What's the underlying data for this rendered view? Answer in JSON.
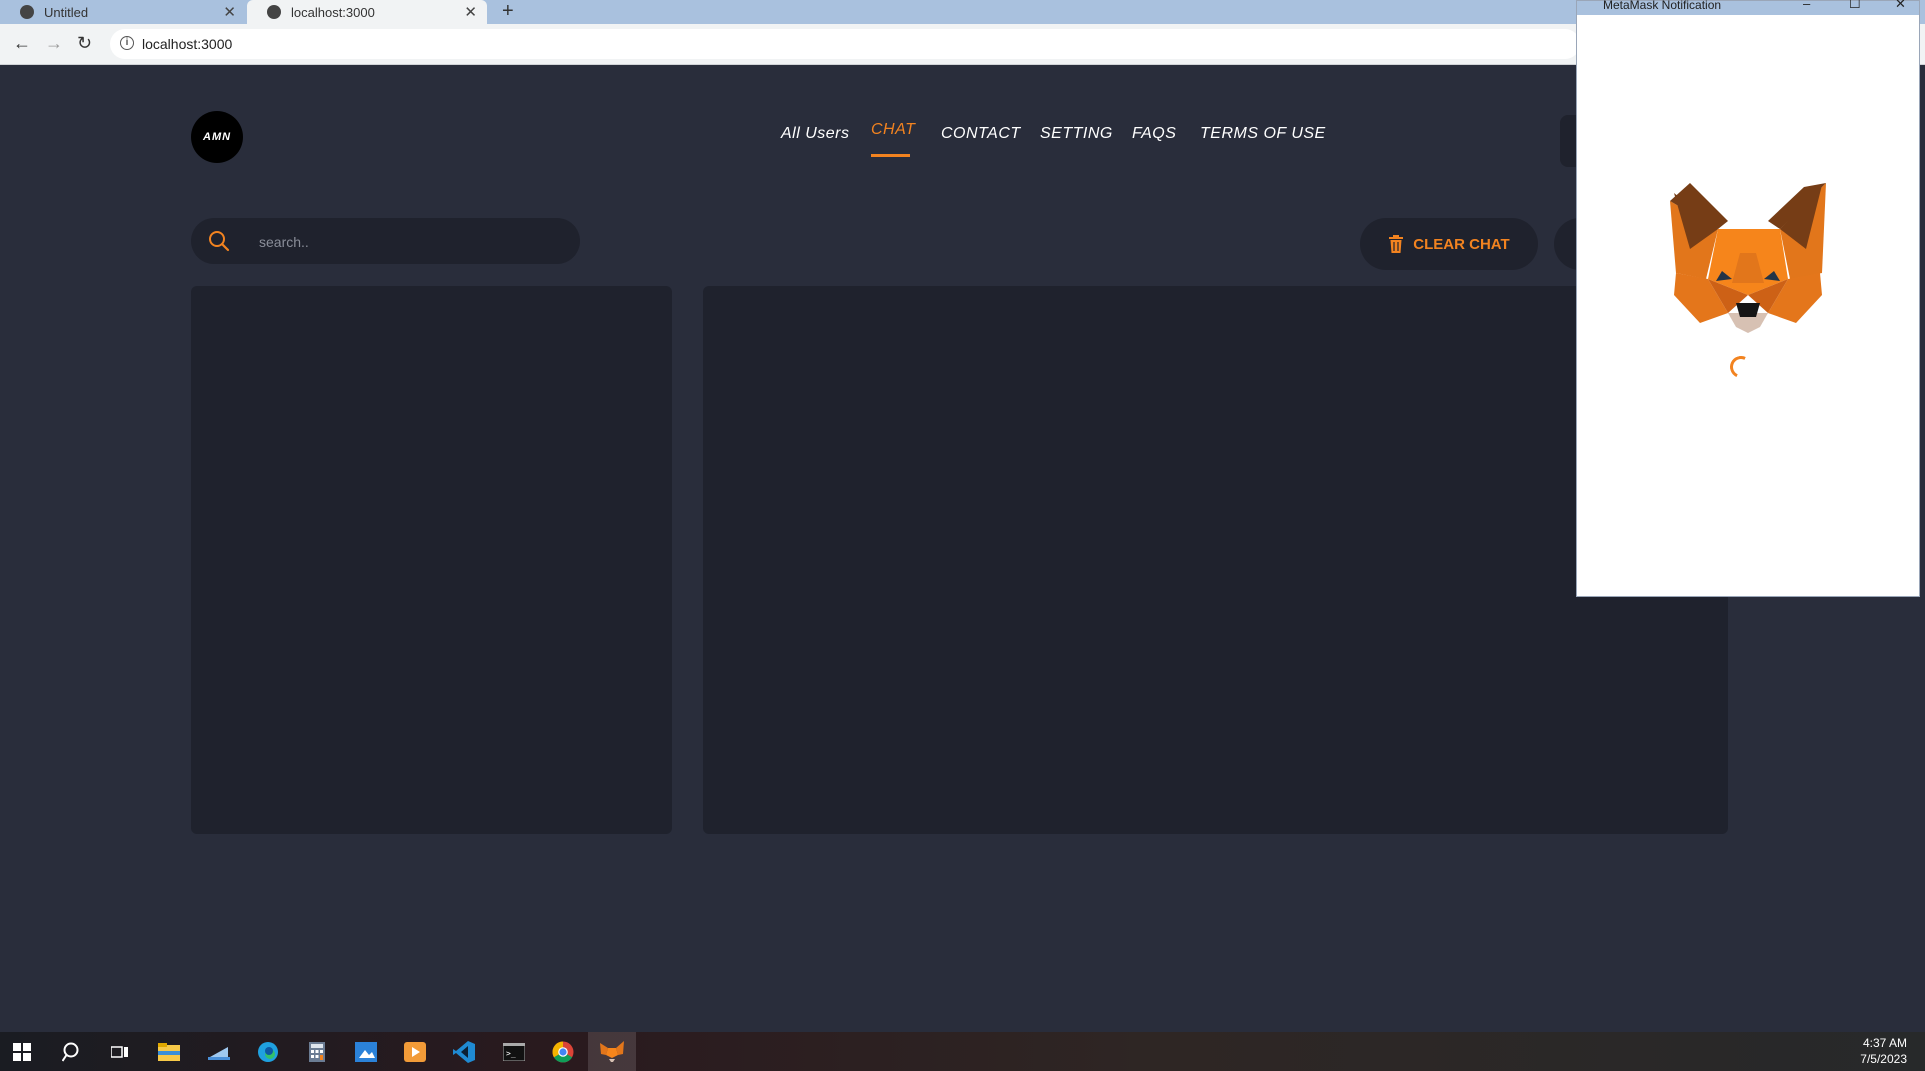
{
  "browser": {
    "tabs": [
      {
        "title": "Untitled",
        "active": false
      },
      {
        "title": "localhost:3000",
        "active": true
      }
    ],
    "url": "localhost:3000"
  },
  "site": {
    "logo_text": "AMN",
    "nav": [
      {
        "label": "All Users",
        "active": false
      },
      {
        "label": "CHAT",
        "active": true
      },
      {
        "label": "CONTACT",
        "active": false
      },
      {
        "label": "SETTING",
        "active": false
      },
      {
        "label": "FAQS",
        "active": false
      },
      {
        "label": "TERMS OF USE",
        "active": false
      }
    ],
    "search_placeholder": "search..",
    "clear_chat_label": "CLEAR CHAT",
    "accent_color": "#f28320"
  },
  "metamask": {
    "window_title": "MetaMask Notification",
    "status": "loading"
  },
  "taskbar": {
    "time": "4:37 AM",
    "date": "7/5/2023",
    "apps": [
      "windows-start-icon",
      "search-icon",
      "task-view-icon",
      "file-explorer-icon",
      "store-icon",
      "edge-icon",
      "calculator-icon",
      "photos-icon",
      "media-player-icon",
      "vscode-icon",
      "terminal-icon",
      "chrome-icon",
      "metamask-fox-icon"
    ]
  }
}
